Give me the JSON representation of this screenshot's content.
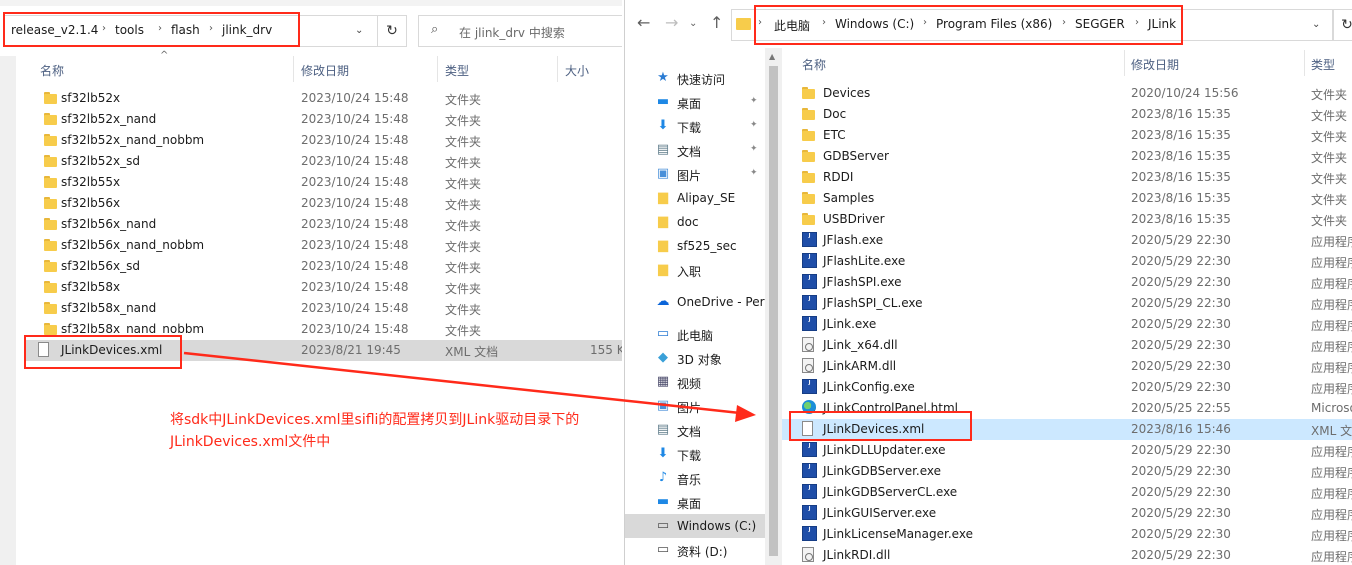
{
  "left": {
    "breadcrumb": [
      "release_v2.1.4",
      "tools",
      "flash",
      "jlink_drv"
    ],
    "search_placeholder": "在 jlink_drv 中搜索",
    "columns": {
      "name": "名称",
      "modified": "修改日期",
      "type": "类型",
      "size": "大小"
    },
    "rows": [
      {
        "name": "sf32lb52x",
        "date": "2023/10/24 15:48",
        "type": "文件夹",
        "size": "",
        "icon": "folder"
      },
      {
        "name": "sf32lb52x_nand",
        "date": "2023/10/24 15:48",
        "type": "文件夹",
        "size": "",
        "icon": "folder"
      },
      {
        "name": "sf32lb52x_nand_nobbm",
        "date": "2023/10/24 15:48",
        "type": "文件夹",
        "size": "",
        "icon": "folder"
      },
      {
        "name": "sf32lb52x_sd",
        "date": "2023/10/24 15:48",
        "type": "文件夹",
        "size": "",
        "icon": "folder"
      },
      {
        "name": "sf32lb55x",
        "date": "2023/10/24 15:48",
        "type": "文件夹",
        "size": "",
        "icon": "folder"
      },
      {
        "name": "sf32lb56x",
        "date": "2023/10/24 15:48",
        "type": "文件夹",
        "size": "",
        "icon": "folder"
      },
      {
        "name": "sf32lb56x_nand",
        "date": "2023/10/24 15:48",
        "type": "文件夹",
        "size": "",
        "icon": "folder"
      },
      {
        "name": "sf32lb56x_nand_nobbm",
        "date": "2023/10/24 15:48",
        "type": "文件夹",
        "size": "",
        "icon": "folder"
      },
      {
        "name": "sf32lb56x_sd",
        "date": "2023/10/24 15:48",
        "type": "文件夹",
        "size": "",
        "icon": "folder"
      },
      {
        "name": "sf32lb58x",
        "date": "2023/10/24 15:48",
        "type": "文件夹",
        "size": "",
        "icon": "folder"
      },
      {
        "name": "sf32lb58x_nand",
        "date": "2023/10/24 15:48",
        "type": "文件夹",
        "size": "",
        "icon": "folder"
      },
      {
        "name": "sf32lb58x_nand_nobbm",
        "date": "2023/10/24 15:48",
        "type": "文件夹",
        "size": "",
        "icon": "folder"
      },
      {
        "name": "JLinkDevices.xml",
        "date": "2023/8/21 19:45",
        "type": "XML 文档",
        "size": "155 K",
        "icon": "file"
      }
    ]
  },
  "right": {
    "breadcrumb": [
      "此电脑",
      "Windows (C:)",
      "Program Files (x86)",
      "SEGGER",
      "JLink"
    ],
    "columns": {
      "name": "名称",
      "modified": "修改日期",
      "type": "类型"
    },
    "nav": [
      {
        "label": "快速访问",
        "icon": "star-icon",
        "glyph": "★",
        "color": "#2b7cd3",
        "pinned": false
      },
      {
        "label": "桌面",
        "icon": "desktop-icon",
        "glyph": "▬",
        "color": "#1e88e5",
        "pinned": true
      },
      {
        "label": "下载",
        "icon": "download-icon",
        "glyph": "⬇",
        "color": "#1e88e5",
        "pinned": true
      },
      {
        "label": "文档",
        "icon": "documents-icon",
        "glyph": "▤",
        "color": "#607d8b",
        "pinned": true
      },
      {
        "label": "图片",
        "icon": "pictures-icon",
        "glyph": "▣",
        "color": "#4a90d9",
        "pinned": true
      },
      {
        "label": "Alipay_SE",
        "icon": "folder-icon",
        "glyph": "▆",
        "color": "#f7cc4b",
        "pinned": false
      },
      {
        "label": "doc",
        "icon": "folder-icon",
        "glyph": "▆",
        "color": "#f7cc4b",
        "pinned": false
      },
      {
        "label": "sf525_sec",
        "icon": "folder-icon",
        "glyph": "▆",
        "color": "#f7cc4b",
        "pinned": false
      },
      {
        "label": "入职",
        "icon": "folder-icon",
        "glyph": "▆",
        "color": "#f7cc4b",
        "pinned": false
      },
      {
        "label": "OneDrive - Perso",
        "icon": "onedrive-icon",
        "glyph": "☁",
        "color": "#0a64d8",
        "pinned": false
      },
      {
        "label": "此电脑",
        "icon": "this-pc-icon",
        "glyph": "▭",
        "color": "#2b7cd3",
        "pinned": false
      },
      {
        "label": "3D 对象",
        "icon": "3d-objects-icon",
        "glyph": "◆",
        "color": "#3aa0d8",
        "pinned": false
      },
      {
        "label": "视频",
        "icon": "videos-icon",
        "glyph": "▦",
        "color": "#4b4b6b",
        "pinned": false
      },
      {
        "label": "图片",
        "icon": "pictures-icon",
        "glyph": "▣",
        "color": "#4a90d9",
        "pinned": false
      },
      {
        "label": "文档",
        "icon": "documents-icon",
        "glyph": "▤",
        "color": "#607d8b",
        "pinned": false
      },
      {
        "label": "下载",
        "icon": "download-icon",
        "glyph": "⬇",
        "color": "#1e88e5",
        "pinned": false
      },
      {
        "label": "音乐",
        "icon": "music-icon",
        "glyph": "♪",
        "color": "#1e88e5",
        "pinned": false
      },
      {
        "label": "桌面",
        "icon": "desktop-icon",
        "glyph": "▬",
        "color": "#1e88e5",
        "pinned": false
      },
      {
        "label": "Windows (C:)",
        "icon": "drive-c-icon",
        "glyph": "▭",
        "color": "#555555",
        "pinned": false
      },
      {
        "label": "资料 (D:)",
        "icon": "drive-d-icon",
        "glyph": "▭",
        "color": "#555555",
        "pinned": false
      }
    ],
    "rows": [
      {
        "name": "Devices",
        "date": "2020/10/24 15:56",
        "type": "文件夹",
        "icon": "folder"
      },
      {
        "name": "Doc",
        "date": "2023/8/16 15:35",
        "type": "文件夹",
        "icon": "folder"
      },
      {
        "name": "ETC",
        "date": "2023/8/16 15:35",
        "type": "文件夹",
        "icon": "folder"
      },
      {
        "name": "GDBServer",
        "date": "2023/8/16 15:35",
        "type": "文件夹",
        "icon": "folder"
      },
      {
        "name": "RDDI",
        "date": "2023/8/16 15:35",
        "type": "文件夹",
        "icon": "folder"
      },
      {
        "name": "Samples",
        "date": "2023/8/16 15:35",
        "type": "文件夹",
        "icon": "folder"
      },
      {
        "name": "USBDriver",
        "date": "2023/8/16 15:35",
        "type": "文件夹",
        "icon": "folder"
      },
      {
        "name": "JFlash.exe",
        "date": "2020/5/29 22:30",
        "type": "应用程序",
        "icon": "exe"
      },
      {
        "name": "JFlashLite.exe",
        "date": "2020/5/29 22:30",
        "type": "应用程序",
        "icon": "exe"
      },
      {
        "name": "JFlashSPI.exe",
        "date": "2020/5/29 22:30",
        "type": "应用程序",
        "icon": "exe"
      },
      {
        "name": "JFlashSPI_CL.exe",
        "date": "2020/5/29 22:30",
        "type": "应用程序",
        "icon": "exe"
      },
      {
        "name": "JLink.exe",
        "date": "2020/5/29 22:30",
        "type": "应用程序",
        "icon": "exe"
      },
      {
        "name": "JLink_x64.dll",
        "date": "2020/5/29 22:30",
        "type": "应用程序",
        "icon": "dll"
      },
      {
        "name": "JLinkARM.dll",
        "date": "2020/5/29 22:30",
        "type": "应用程序",
        "icon": "dll"
      },
      {
        "name": "JLinkConfig.exe",
        "date": "2020/5/29 22:30",
        "type": "应用程序",
        "icon": "exe"
      },
      {
        "name": "JLinkControlPanel.html",
        "date": "2020/5/25 22:55",
        "type": "Microso",
        "icon": "html"
      },
      {
        "name": "JLinkDevices.xml",
        "date": "2023/8/16 15:46",
        "type": "XML 文",
        "icon": "file"
      },
      {
        "name": "JLinkDLLUpdater.exe",
        "date": "2020/5/29 22:30",
        "type": "应用程序",
        "icon": "exe"
      },
      {
        "name": "JLinkGDBServer.exe",
        "date": "2020/5/29 22:30",
        "type": "应用程序",
        "icon": "exe"
      },
      {
        "name": "JLinkGDBServerCL.exe",
        "date": "2020/5/29 22:30",
        "type": "应用程序",
        "icon": "exe"
      },
      {
        "name": "JLinkGUIServer.exe",
        "date": "2020/5/29 22:30",
        "type": "应用程序",
        "icon": "exe"
      },
      {
        "name": "JLinkLicenseManager.exe",
        "date": "2020/5/29 22:30",
        "type": "应用程序",
        "icon": "exe"
      },
      {
        "name": "JLinkRDI.dll",
        "date": "2020/5/29 22:30",
        "type": "应用程序",
        "icon": "dll"
      }
    ]
  },
  "annotation": {
    "line1": "将sdk中JLinkDevices.xml里sifli的配置拷贝到JLink驱动目录下的",
    "line2": "JLinkDevices.xml文件中",
    "color": "#ff2a1a"
  },
  "exe_icon_text": "J\nLink"
}
